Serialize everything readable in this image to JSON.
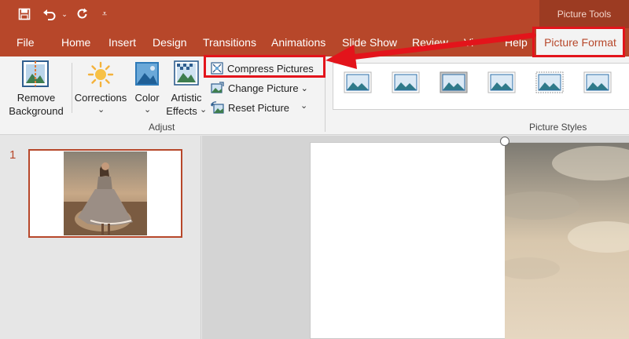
{
  "window": {
    "contextual_tab_group": "Picture Tools"
  },
  "tabs": [
    {
      "label": "File"
    },
    {
      "label": "Home"
    },
    {
      "label": "Insert"
    },
    {
      "label": "Design"
    },
    {
      "label": "Transitions"
    },
    {
      "label": "Animations"
    },
    {
      "label": "Slide Show"
    },
    {
      "label": "Review"
    },
    {
      "label": "Vi"
    },
    {
      "label": "Help"
    }
  ],
  "active_tab": {
    "label": "Picture Format"
  },
  "adjust": {
    "remove_background": {
      "line1": "Remove",
      "line2": "Background",
      "icon": "remove-background-icon"
    },
    "corrections": {
      "label": "Corrections",
      "icon": "sun-icon"
    },
    "color": {
      "label": "Color",
      "icon": "color-landscape-icon"
    },
    "artistic_effects": {
      "line1": "Artistic",
      "line2": "Effects",
      "icon": "artistic-effects-icon"
    },
    "compress_pictures": {
      "label": "Compress Pictures",
      "icon": "compress-icon"
    },
    "change_picture": {
      "label": "Change Picture",
      "icon": "change-picture-icon"
    },
    "reset_picture": {
      "label": "Reset Picture",
      "icon": "reset-picture-icon"
    },
    "group_label": "Adjust"
  },
  "picture_styles": {
    "group_label": "Picture Styles",
    "count": 6
  },
  "slides": [
    {
      "number": "1"
    }
  ],
  "colors": {
    "accent": "#b7472a",
    "highlight": "#e3141b"
  }
}
